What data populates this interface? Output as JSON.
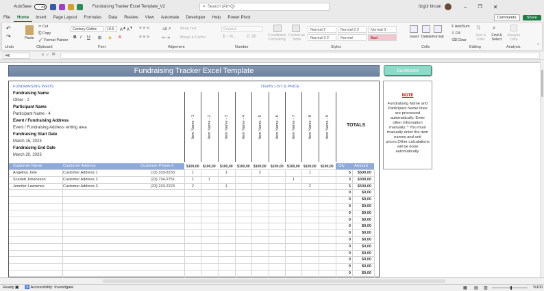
{
  "titlebar": {
    "autosave": "AutoSave",
    "toggle": "Off",
    "filename": "Fundraising Tracker Excel Template_V2",
    "search": "Search (Alt+Q)",
    "user": "özgür bircan"
  },
  "tabs": [
    "File",
    "Home",
    "Insert",
    "Page Layout",
    "Formulas",
    "Data",
    "Review",
    "View",
    "Automate",
    "Developer",
    "Help",
    "Power Pivot"
  ],
  "ribbon_right": {
    "comments": "Comments",
    "share": "Share"
  },
  "ribbon": {
    "undo": "Undo",
    "paste": "Paste",
    "cut": "Cut",
    "copy": "Copy",
    "format_painter": "Format Painter",
    "clipboard": "Clipboard",
    "font_name": "Century Gothic",
    "font_size": "10.5",
    "font": "Font",
    "wrap": "Wrap Text",
    "merge": "Merge & Center",
    "alignment": "Alignment",
    "number_format": "General",
    "number": "Number",
    "cond_format": "Conditional Formatting",
    "format_table": "Format as Table",
    "styles_list": [
      "Normal 2",
      "Normal 2 2",
      "Normal 3",
      "Normal 3 2",
      "Normal",
      "Bad"
    ],
    "styles": "Styles",
    "insert": "Insert",
    "delete": "Delete",
    "format": "Format",
    "cells": "Cells",
    "autosum": "AutoSum",
    "fill": "Fill",
    "clear": "Clear",
    "sort": "Sort & Filter",
    "find": "Find & Select",
    "editing": "Editing",
    "analyze": "Analyze Data",
    "analysis": "Analysis"
  },
  "formulabar": {
    "cellref": "I46",
    "fx": "fx"
  },
  "sheet": {
    "title": "Fundraising Tracker Excel Template",
    "dashboard": "Dashboard",
    "infos_header": "FUNDRAISING INFOS",
    "items_header": "ITEMS LIST & PRICE",
    "fields": [
      {
        "label": "Fundraising Name",
        "value": "Other - 2"
      },
      {
        "label": "Participant Name",
        "value": "Participant Name - 4"
      },
      {
        "label": "Event / Fundraising Address",
        "value": "Event / Fundraising Address writing area"
      },
      {
        "label": "Fundraising Start Date",
        "value": "March 15, 2023"
      },
      {
        "label": "Fundraising End Date",
        "value": "March 20, 2023"
      }
    ],
    "items": [
      "Item Name - 1",
      "Item Name - 2",
      "Item Name - 3",
      "Item Name - 4",
      "Item Name - 5",
      "Item Name - 6",
      "Item Name - 7",
      "Item Name - 8",
      "Item Name - 9"
    ],
    "totals": "TOTALS",
    "prices": [
      "$100,00",
      "$100,00",
      "$100,00",
      "$100,00",
      "$100,00",
      "$100,00",
      "$100,00",
      "$100,00",
      "$100,00"
    ],
    "col_headers": {
      "name": "Customer Name",
      "address": "Customer Address",
      "phone": "Customer Phone #",
      "qty": "Qty",
      "amount": "Amount"
    },
    "rows": [
      {
        "name": "Angelina Jolie",
        "address": "Customer Address 1",
        "phone": "(12) 333-2233",
        "q": [
          "1",
          "",
          "1",
          "",
          "2",
          "",
          "",
          "1",
          ""
        ],
        "qty": "5",
        "amount": "$500,00"
      },
      {
        "name": "Scarlett Johansson",
        "address": "Customer Address 2",
        "phone": "(23) 734-2751",
        "q": [
          "1",
          "1",
          "",
          "",
          "",
          "",
          "1",
          "",
          ""
        ],
        "qty": "3",
        "amount": "$300,00"
      },
      {
        "name": "Jennifer Lawrence",
        "address": "Customer Address 3",
        "phone": "(23) 233-2223",
        "q": [
          "2",
          "",
          "1",
          "",
          "",
          "",
          "",
          "2",
          ""
        ],
        "qty": "5",
        "amount": "$500,00"
      }
    ],
    "empty_qty": "0",
    "empty_amount": "$0,00",
    "note_title": "NOTE",
    "note_text": "Fundraising Name and Participant Name lines are processed automatically. Enter other information manually. * You must manually enter the item names and unit prices.Other calculations will be done automatically."
  },
  "status": {
    "ready": "Ready",
    "accessibility": "Accessibility: Investigate",
    "zoom": "%100"
  }
}
